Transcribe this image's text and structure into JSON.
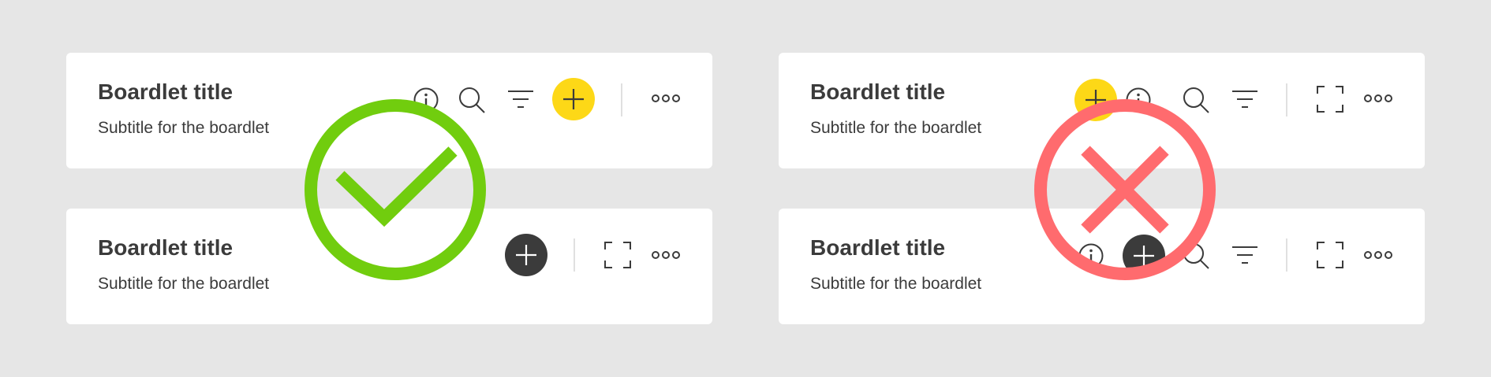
{
  "colors": {
    "background": "#e6e6e6",
    "card": "#ffffff",
    "text": "#3b3b3b",
    "accent_yellow": "#fdd817",
    "accent_dark": "#3b3b3b",
    "correct_green": "#71cd0e",
    "incorrect_red": "#ff6b6e"
  },
  "examples": [
    {
      "verdict": "correct",
      "verdict_icon": "checkmark-icon",
      "cards": [
        {
          "title": "Boardlet title",
          "subtitle": "Subtitle for the boardlet",
          "actions": [
            "info-icon",
            "search-icon",
            "filter-icon",
            "add-button-yellow",
            "more-icon"
          ]
        },
        {
          "title": "Boardlet title",
          "subtitle": "Subtitle for the boardlet",
          "actions": [
            "add-button-dark",
            "expand-icon",
            "more-icon"
          ]
        }
      ]
    },
    {
      "verdict": "incorrect",
      "verdict_icon": "cross-icon",
      "cards": [
        {
          "title": "Boardlet title",
          "subtitle": "Subtitle for the boardlet",
          "actions": [
            "add-button-yellow",
            "info-icon",
            "search-icon",
            "filter-icon",
            "expand-icon",
            "more-icon"
          ]
        },
        {
          "title": "Boardlet title",
          "subtitle": "Subtitle for the boardlet",
          "actions": [
            "info-icon",
            "add-button-dark",
            "search-icon",
            "filter-icon",
            "expand-icon",
            "more-icon"
          ]
        }
      ]
    }
  ]
}
